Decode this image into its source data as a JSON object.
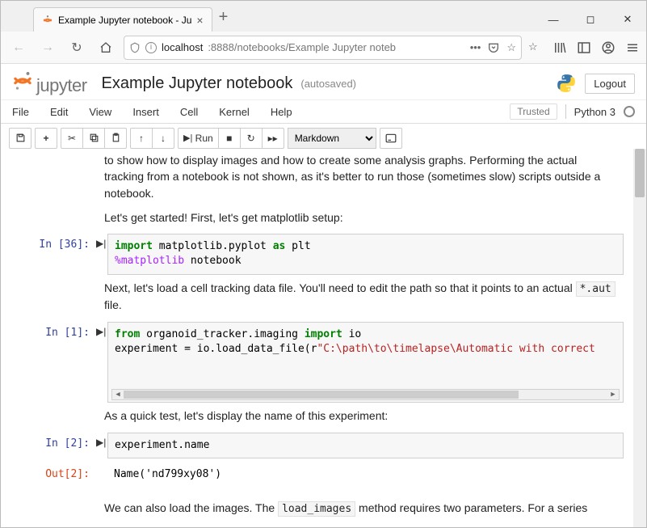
{
  "browser": {
    "tab_title": "Example Jupyter notebook - Ju",
    "url_host": "localhost",
    "url_path": ":8888/notebooks/Example Jupyter noteb"
  },
  "header": {
    "logo_text": "jupyter",
    "notebook_name": "Example Jupyter notebook",
    "autosaved": "(autosaved)",
    "logout": "Logout"
  },
  "menubar": {
    "items": [
      "File",
      "Edit",
      "View",
      "Insert",
      "Cell",
      "Kernel",
      "Help"
    ],
    "trusted": "Trusted",
    "kernel": "Python 3"
  },
  "toolbar": {
    "run_label": "Run",
    "cell_type": "Markdown"
  },
  "cells": {
    "md0": "to show how to display images and how to create some analysis graphs. Performing the actual tracking from a notebook is not shown, as it's better to run those (sometimes slow) scripts outside a notebook.",
    "md1": "Let's get started! First, let's get matplotlib setup:",
    "in36_prompt": "In [36]:",
    "in36_code_l1_kw": "import",
    "in36_code_l1_mid": " matplotlib.pyplot ",
    "in36_code_l1_as": "as",
    "in36_code_l1_alias": " plt",
    "in36_code_l2_magic": "%matplotlib",
    "in36_code_l2_arg": " notebook",
    "md2_pre": "Next, let's load a cell tracking data file. You'll need to edit the path so that it points to an actual ",
    "md2_code": "*.aut",
    "md2_post": " file.",
    "in1_prompt": "In [1]:",
    "in1_l1_from": "from",
    "in1_l1_mod": " organoid_tracker.imaging ",
    "in1_l1_import": "import",
    "in1_l1_name": " io",
    "in1_l2_pre": "experiment = io.load_data_file(r",
    "in1_l2_str": "\"C:\\path\\to\\timelapse\\Automatic with correct",
    "md3": "As a quick test, let's display the name of this experiment:",
    "in2_prompt": "In [2]:",
    "in2_code": "experiment.name",
    "out2_prompt": "Out[2]:",
    "out2_val": "Name('nd799xy08')",
    "md4_pre": "We can also load the images. The ",
    "md4_code": "load_images",
    "md4_post": " method requires two parameters. For a series"
  }
}
